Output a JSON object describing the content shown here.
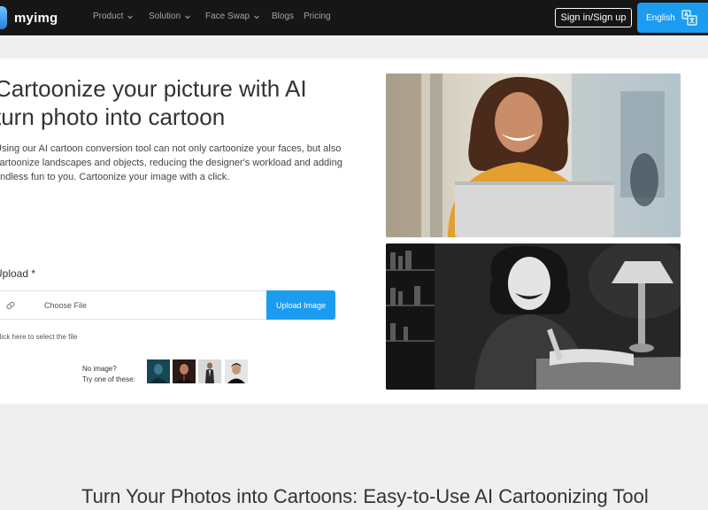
{
  "nav": {
    "logo": "myimg",
    "items": [
      {
        "label": "Product",
        "dropdown": true
      },
      {
        "label": "Solution",
        "dropdown": true
      },
      {
        "label": "Face Swap",
        "dropdown": true
      },
      {
        "label": "Blogs",
        "dropdown": false
      },
      {
        "label": "Pricing",
        "dropdown": false
      }
    ],
    "signin": "Sign in/Sign up",
    "language": "English"
  },
  "hero": {
    "title_line1": "Cartoonize your picture with AI",
    "title_line2": "turn photo into cartoon",
    "desc_line1": "Using our AI cartoon conversion tool can not only cartoonize your faces, but also",
    "desc_line2": "cartoonize landscapes and objects, reducing the designer's workload and adding",
    "desc_line3": "endless fun to you. Cartoonize your image with a click.",
    "upload_label": "Upload *",
    "file_placeholder": "Choose File",
    "upload_button": "Upload Image",
    "click_hint": "Click here to select the file",
    "samples_line1": "No image?",
    "samples_line2": "Try one of these:"
  },
  "section": {
    "title": "Turn Your Photos into Cartoons: Easy-to-Use AI Cartoonizing Tool"
  },
  "colors": {
    "accent": "#1c9cf0",
    "navbar": "#161616",
    "page_bg": "#efefef"
  },
  "icons": [
    "chevron-down-icon",
    "translate-icon",
    "link-icon"
  ]
}
